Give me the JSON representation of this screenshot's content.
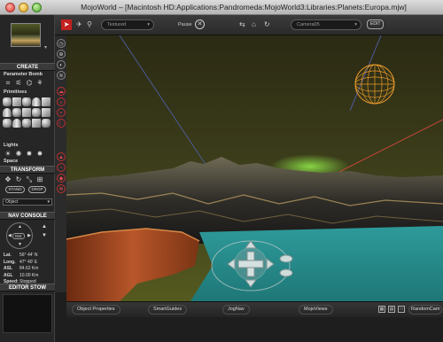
{
  "window": {
    "title": "MojoWorld – [Macintosh HD:Applications:Pandromeda:MojoWorld3:Libraries:Planets:Europa.mjw]"
  },
  "toolbar": {
    "render_mode": "Textured",
    "pause_label": "Pause",
    "camera": "Camera05",
    "edit_label": "EDIT"
  },
  "sidebar": {
    "create_header": "CREATE",
    "parameter_bomb_label": "Parameter Bomb",
    "primitives_label": "Primitives",
    "lights_label": "Lights",
    "space_label": "Space",
    "transform_header": "TRANSFORM",
    "stand_label": "STAND",
    "drop_label": "DROP",
    "object_select": "Object",
    "nav_console_header": "NAV CONSOLE",
    "nav_mode": "NW",
    "nav": [
      {
        "key": "Lat.",
        "value": "56° 44' N"
      },
      {
        "key": "Long.",
        "value": "47° 40' E"
      },
      {
        "key": "ASL",
        "value": "84.62 Km"
      },
      {
        "key": "AGL",
        "value": "10.00 Km"
      },
      {
        "key": "Speed:",
        "value": "Stopped"
      }
    ],
    "editor_stow_header": "EDITOR STOW"
  },
  "bottom_bar": {
    "object_properties": "Object Properties",
    "smart_guides": "SmartGuides",
    "jog_nav": "JogNav",
    "mojo_views": "MojoViews",
    "random_cam": "RandomCam"
  },
  "colors": {
    "accent_red": "#c42020",
    "sky": "#3a3a1c",
    "water": "#2a8f8f",
    "sphere_wireframe": "#e89a2a"
  }
}
